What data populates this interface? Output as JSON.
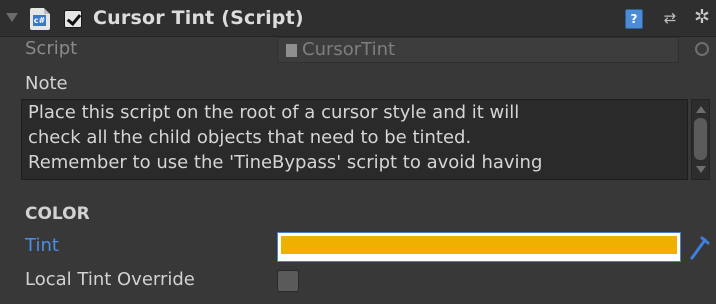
{
  "component": {
    "title": "Cursor Tint (Script)",
    "enabled": true,
    "icon_label": "c#"
  },
  "fields": {
    "script_label": "Script",
    "script_value": "CursorTint",
    "note_label": "Note",
    "note_text": "Place this script on the root of a cursor style and it will\ncheck all the child objects that need to be tinted.\nRemember to use the 'TineBypass' script to avoid having",
    "section_header": "COLOR",
    "tint_label": "Tint",
    "tint_color": "#f0b000",
    "local_tint_label": "Local Tint Override",
    "local_tint_checked": false
  },
  "icons": {
    "foldout": "foldout-arrow-icon",
    "script": "cs-script-icon",
    "help": "help-book-icon",
    "help_glyph": "?",
    "preset": "preset-sliders-icon",
    "preset_glyph": "⇄",
    "gear": "gear-icon",
    "gear_glyph": "✲",
    "object_picker": "object-picker-icon",
    "eyedropper": "eyedropper-icon"
  },
  "colors": {
    "background": "#383838",
    "header": "#2f2f2f",
    "accent_blue": "#4c8ee6",
    "tint": "#f0b000"
  }
}
